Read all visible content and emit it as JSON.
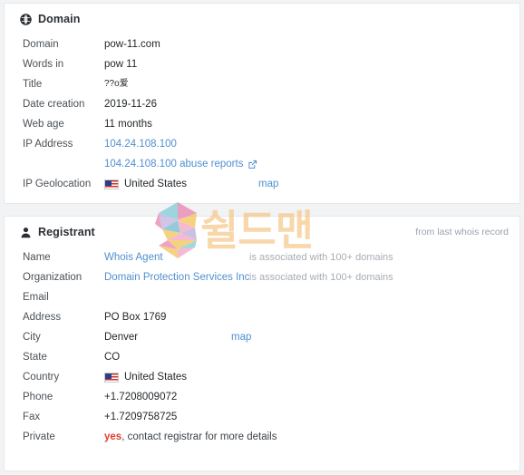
{
  "watermark": {
    "logo_letter": "S",
    "text": "쉴드맨",
    "color": "#f6c98a"
  },
  "domain_card": {
    "icon": "globe-icon",
    "title": "Domain",
    "rows": [
      {
        "label": "Domain",
        "value": "pow-11.com"
      },
      {
        "label": "Words in",
        "value": "pow 11"
      },
      {
        "label": "Title",
        "value": "??o爱"
      },
      {
        "label": "Date creation",
        "value": "2019-11-26"
      },
      {
        "label": "Web age",
        "value": "11 months"
      }
    ],
    "ip_address": {
      "label": "IP Address",
      "ip_link": "104.24.108.100",
      "abuse_link": "104.24.108.100 abuse reports",
      "external_icon": "external-link-icon"
    },
    "geolocation": {
      "label": "IP Geolocation",
      "flag": "us-flag-icon",
      "country": "United States",
      "map_link": "map"
    }
  },
  "registrant_card": {
    "icon": "user-icon",
    "title": "Registrant",
    "note": "from last whois record",
    "assoc_note": "is associated with 100+ domains",
    "rows": {
      "name": {
        "label": "Name",
        "value": "Whois Agent"
      },
      "organization": {
        "label": "Organization",
        "value": "Domain Protection Services Inc"
      },
      "email": {
        "label": "Email",
        "value": ""
      },
      "address": {
        "label": "Address",
        "value": "PO Box 1769"
      },
      "city": {
        "label": "City",
        "value": "Denver",
        "map_link": "map"
      },
      "state": {
        "label": "State",
        "value": "CO"
      },
      "country": {
        "label": "Country",
        "value": "United States",
        "flag": "us-flag-icon"
      },
      "phone": {
        "label": "Phone",
        "value": "+1.7208009072"
      },
      "fax": {
        "label": "Fax",
        "value": "+1.7209758725"
      },
      "private": {
        "label": "Private",
        "value_highlight": "yes",
        "value_rest": ", contact registrar for more details"
      }
    }
  },
  "colors": {
    "link": "#4f8fd0",
    "muted": "#a6adb4",
    "danger": "#e23a30",
    "page_bg": "#f2f3f5",
    "card_bg": "#ffffff",
    "border": "#e6e8ea"
  }
}
